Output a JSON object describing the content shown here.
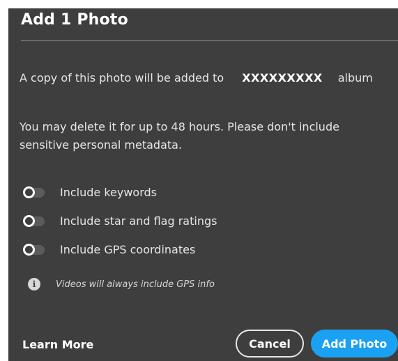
{
  "dialog": {
    "title": "Add 1 Photo",
    "copy_prefix": "A copy of this photo will be added to",
    "album_name": "XXXXXXXXX",
    "copy_suffix": "album",
    "delete_notice": "You may delete it for up to 48 hours. Please don't include sensitive personal metadata.",
    "options": [
      {
        "label": "Include keywords",
        "enabled": false
      },
      {
        "label": "Include star and flag ratings",
        "enabled": false
      },
      {
        "label": "Include GPS coordinates",
        "enabled": false
      }
    ],
    "info_icon": "info-icon",
    "info_text": "Videos will always include GPS info",
    "learn_more": "Learn More",
    "cancel_label": "Cancel",
    "add_label": "Add Photo"
  },
  "colors": {
    "background": "#3e3e3e",
    "primary_button": "#1ba1f2",
    "text": "#e6e6e6"
  }
}
